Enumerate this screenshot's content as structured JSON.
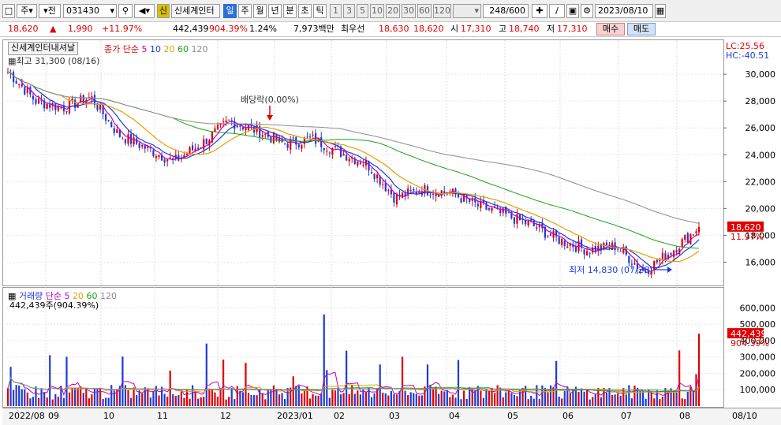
{
  "toolbar": {
    "type_btn": "주",
    "market_btn": "전",
    "code": "031430",
    "badge": "신",
    "name": "신세계인터",
    "periods": [
      "일",
      "주",
      "월",
      "년",
      "분",
      "초",
      "틱"
    ],
    "active_period": "일",
    "intervals": [
      "1",
      "3",
      "5",
      "10",
      "20",
      "30",
      "60",
      "120"
    ],
    "count": "248",
    "count_total": "/600",
    "date": "2023/08/10"
  },
  "info": {
    "price": "18,620",
    "change": "1,990",
    "change_pct": "+11.97%",
    "volume": "442,439",
    "volume_pct": "904.39%",
    "turnover": "1.24%",
    "amount": "7,973백만",
    "pref_label": "최우선",
    "ask": "18,630",
    "bid": "18,620",
    "open_label": "시",
    "open": "17,310",
    "high_label": "고",
    "high": "18,740",
    "low_label": "저",
    "low": "17,310",
    "buy_label": "매수",
    "sell_label": "매도"
  },
  "price_panel": {
    "name_tab": "신세계인터내셔날",
    "legend_prefix": "종가 단순",
    "ma_periods": [
      "5",
      "10",
      "20",
      "60",
      "120"
    ],
    "ma_colors": [
      "#c000c0",
      "#1f3bd6",
      "#e6a000",
      "#1aa11a",
      "#8c8c8c"
    ],
    "high_note": "최고 31,300 (08/16)",
    "dividend_note": "배당락(0.00%)",
    "low_note": "최저 14,830 (07/26)",
    "lc_label": "LC:25.56",
    "hc_label": "HC:-40.51",
    "last_price": "18,620",
    "last_pct": "11.97%",
    "y_ticks": [
      "30,000",
      "28,000",
      "26,000",
      "24,000",
      "22,000",
      "20,000",
      "18,000",
      "16,000"
    ]
  },
  "volume_panel": {
    "legend_title": "거래량",
    "legend_prefix": "단순",
    "ma_periods": [
      "5",
      "20",
      "60",
      "120"
    ],
    "ma_colors": [
      "#c000c0",
      "#e6a000",
      "#1aa11a",
      "#8c8c8c"
    ],
    "current": "442,439주(904.39%)",
    "last_volume": "442,439",
    "last_pct": "904.39%",
    "y_ticks": [
      "600,000",
      "500,000",
      "400,000",
      "300,000",
      "200,000",
      "100,000"
    ]
  },
  "x_axis": {
    "labels": [
      "2022/08",
      "09",
      "10",
      "11",
      "12",
      "2023/01",
      "02",
      "03",
      "04",
      "05",
      "06",
      "07",
      "08"
    ],
    "right_label": "08/10"
  },
  "colors": {
    "up": "#e00000",
    "down": "#1f3bd6",
    "accent": "#2d6fd6"
  },
  "chart_data": {
    "type": "candlestick",
    "title": "신세계인터내셔날",
    "ylim": [
      14500,
      31300
    ],
    "y_ticks": [
      16000,
      18000,
      20000,
      22000,
      24000,
      26000,
      28000,
      30000
    ],
    "months": [
      "2022/08",
      "09",
      "10",
      "11",
      "12",
      "2023/01",
      "02",
      "03",
      "04",
      "05",
      "06",
      "07",
      "08"
    ],
    "close_points": [
      {
        "date": "2022/08",
        "value": 30200
      },
      {
        "date": "2022/09 early",
        "value": 28000
      },
      {
        "date": "2022/09 mid",
        "value": 27500
      },
      {
        "date": "2022/09 late",
        "value": 28300
      },
      {
        "date": "2022/10",
        "value": 25500
      },
      {
        "date": "2022/10 late",
        "value": 24500
      },
      {
        "date": "2022/11",
        "value": 23500
      },
      {
        "date": "2022/11 late",
        "value": 24800
      },
      {
        "date": "2022/12 early",
        "value": 26500
      },
      {
        "date": "2022/12 late",
        "value": 25800
      },
      {
        "date": "2023/01",
        "value": 24800
      },
      {
        "date": "2023/01 late",
        "value": 25200
      },
      {
        "date": "2023/02",
        "value": 24200
      },
      {
        "date": "2023/02 late",
        "value": 23300
      },
      {
        "date": "2023/03",
        "value": 20800
      },
      {
        "date": "2023/03 late",
        "value": 21400
      },
      {
        "date": "2023/04",
        "value": 21200
      },
      {
        "date": "2023/04 late",
        "value": 20200
      },
      {
        "date": "2023/05",
        "value": 19500
      },
      {
        "date": "2023/05 late",
        "value": 18700
      },
      {
        "date": "2023/06",
        "value": 17600
      },
      {
        "date": "2023/06 late",
        "value": 16900
      },
      {
        "date": "2023/07",
        "value": 17200
      },
      {
        "date": "2023/07 late",
        "value": 15300
      },
      {
        "date": "2023/08",
        "value": 16800
      },
      {
        "date": "2023/08/10",
        "value": 18620
      }
    ],
    "annotations": [
      "최고 31,300 (08/16)",
      "배당락(0.00%)",
      "최저 14,830 (07/26)"
    ],
    "volume_ylim": [
      0,
      650000
    ],
    "volume_last": 442439
  }
}
